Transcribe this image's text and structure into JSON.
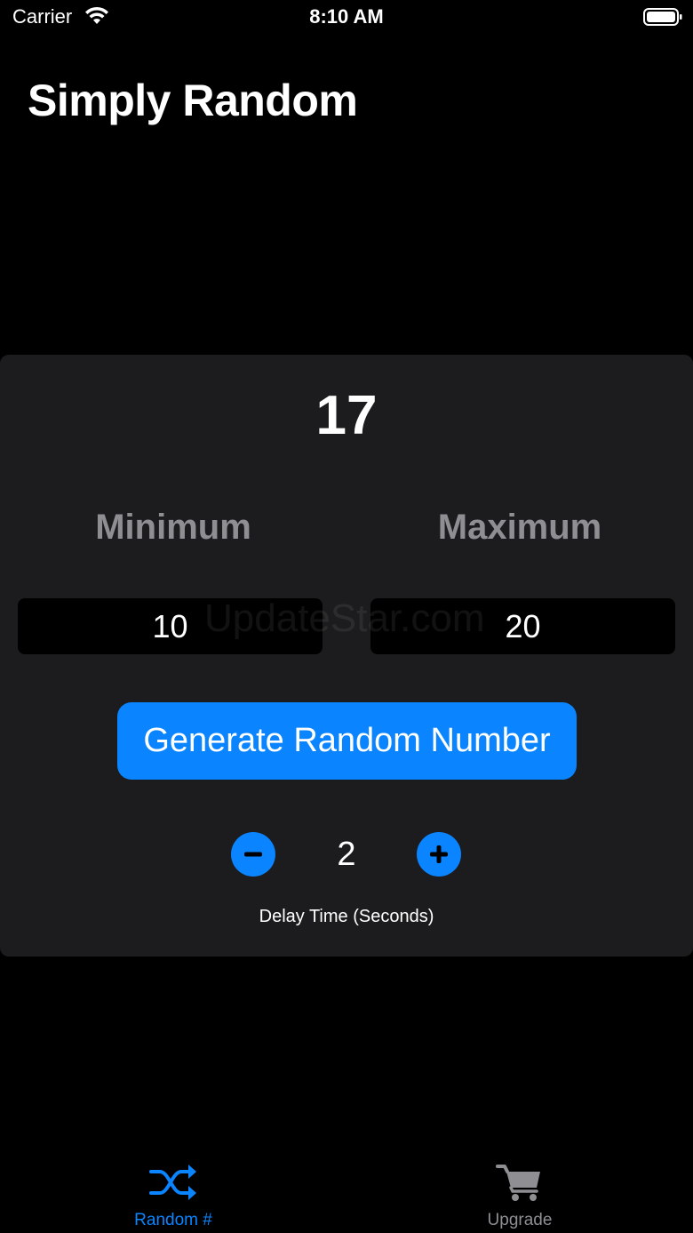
{
  "status_bar": {
    "carrier": "Carrier",
    "time": "8:10 AM",
    "icons": [
      "wifi-icon",
      "battery-icon"
    ]
  },
  "title": "Simply Random",
  "result": "17",
  "range": {
    "min_label": "Minimum",
    "max_label": "Maximum",
    "min_value": "10",
    "max_value": "20"
  },
  "watermark": "UpdateStar.com",
  "generate_label": "Generate Random Number",
  "delay": {
    "value": "2",
    "label": "Delay Time (Seconds)",
    "decrement_icon": "minus-circle-icon",
    "increment_icon": "plus-circle-icon"
  },
  "tabs": [
    {
      "label": "Random #",
      "icon": "shuffle-icon",
      "selected": true
    },
    {
      "label": "Upgrade",
      "icon": "cart-icon",
      "selected": false
    }
  ],
  "colors": {
    "accent": "#0a84ff",
    "card": "#1c1c1e",
    "muted": "#8e8e93",
    "background": "#000000"
  }
}
